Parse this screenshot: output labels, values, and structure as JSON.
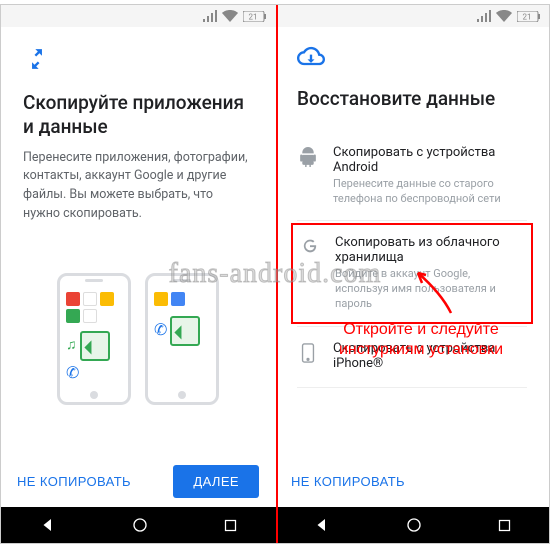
{
  "left": {
    "title": "Скопируйте приложения и данные",
    "subtitle": "Перенесите приложения, фотографии, контакты, аккаунт Google и другие файлы. Вы можете выбрать, что нужно скопировать.",
    "skip": "НЕ КОПИРОВАТЬ",
    "next": "ДАЛЕЕ"
  },
  "right": {
    "title": "Восстановите данные",
    "options": [
      {
        "title": "Скопировать с устройства Android",
        "sub": "Перенесите данные со старого телефона по беспроводной сети"
      },
      {
        "title": "Скопировать из облачного хранилища",
        "sub": "Войдите в аккаунт Google, используя имя пользователя и пароль"
      },
      {
        "title": "Скопировать с устройства iPhone®",
        "sub": ""
      }
    ],
    "skip": "НЕ КОПИРОВАТЬ"
  },
  "annotation": "Откройте и следуйте инстуркиям установки",
  "watermark": "fans-android.com",
  "status": {
    "battery": "21"
  }
}
